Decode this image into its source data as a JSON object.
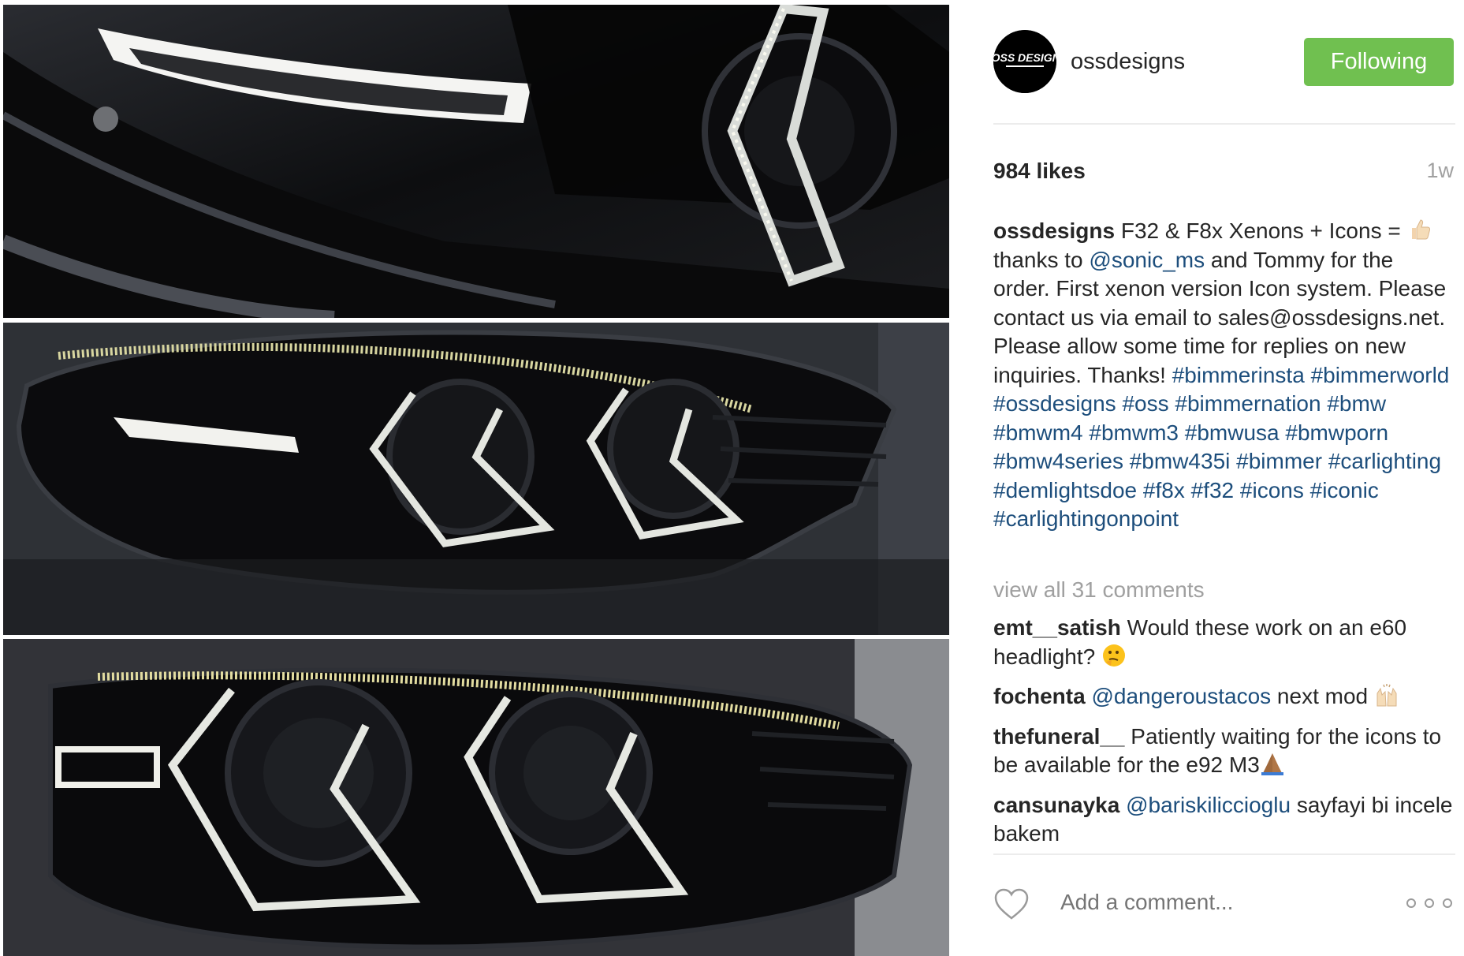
{
  "profile": {
    "username": "ossdesigns",
    "avatar_icon": "oss-designs-logo",
    "avatar_text": "///OSS DESIGNS",
    "follow_label": "Following",
    "follow_color": "#70c050"
  },
  "stats": {
    "likes": "984 likes",
    "time": "1w"
  },
  "caption": {
    "user": "ossdesigns",
    "p1": " F32 & F8x Xenons + Icons = ",
    "emoji1": "thumbs-up-icon",
    "p2": " thanks to ",
    "mention1": "@sonic_ms",
    "p3": " and Tommy for the order. First xenon version Icon system. Please contact us via email to sales@ossdesigns.net. Please allow some time for replies on new inquiries. Thanks! ",
    "hashtags": [
      "#bimmerinsta",
      "#bimmerworld",
      "#ossdesigns",
      "#oss",
      "#bimmernation",
      "#bmw",
      "#bmwm4",
      "#bmwm3",
      "#bmwusa",
      "#bmwporn",
      "#bmw4series",
      "#bmw435i",
      "#bimmer",
      "#carlighting",
      "#demlightsdoe",
      "#f8x",
      "#f32",
      "#icons",
      "#iconic",
      "#carlightingonpoint"
    ]
  },
  "view_all": "view all 31 comments",
  "comments": [
    {
      "user": "emt__satish",
      "text": " Would these work on an e60 headlight? ",
      "emoji": "thinking-face-icon"
    },
    {
      "user": "fochenta",
      "mention": "@dangeroustacos",
      "text": " next mod ",
      "emoji": "raised-hands-icon"
    },
    {
      "user": "thefuneral__",
      "text": " Patiently waiting for the icons to be available for the e92 M3",
      "emoji": "praying-hands-icon"
    },
    {
      "user": "cansunayka",
      "mention": "@bariskiliccioglu",
      "text": " sayfayi bi incele bakem"
    }
  ],
  "footer": {
    "placeholder": "Add a comment...",
    "like_icon": "heart-outline-icon",
    "more_icon": "more-options-icon"
  },
  "colors": {
    "link": "#1d4e7c",
    "muted": "#a0a0a0",
    "text": "#262626"
  }
}
